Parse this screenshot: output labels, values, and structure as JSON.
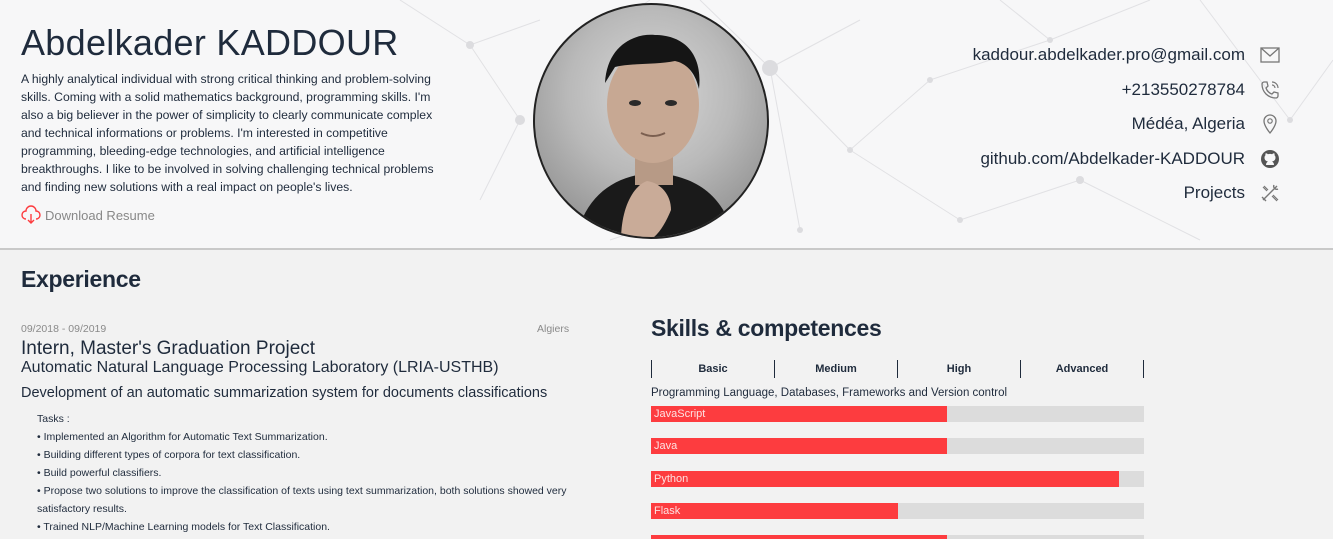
{
  "profile": {
    "name": "Abdelkader KADDOUR",
    "bio": "A highly analytical individual with strong critical thinking and problem-solving skills. Coming with a solid mathematics background, programming skills. I'm also a big believer in the power of simplicity to clearly communicate complex and technical informations or problems. I'm interested in competitive programming, bleeding-edge technologies, and artificial intelligence breakthroughs. I like to be involved in solving challenging technical problems and finding new solutions with a real impact on people's lives.",
    "download_label": "Download Resume"
  },
  "contact": [
    {
      "text": "kaddour.abdelkader.pro@gmail.com",
      "icon": "mail-icon"
    },
    {
      "text": "+213550278784",
      "icon": "phone-icon"
    },
    {
      "text": "Médéa, Algeria",
      "icon": "location-pin-icon"
    },
    {
      "text": "github.com/Abdelkader-KADDOUR",
      "icon": "github-icon"
    },
    {
      "text": "Projects",
      "icon": "tools-icon"
    }
  ],
  "experience": {
    "title": "Experience",
    "date": "09/2018 - 09/2019",
    "location": "Algiers",
    "job_title": "Intern, Master's Graduation Project",
    "org": "Automatic Natural Language Processing Laboratory (LRIA-USTHB)",
    "description": "Development of an automatic summarization system for documents classifications",
    "tasks_label": "Tasks :",
    "tasks": [
      "Implemented an Algorithm for Automatic Text Summarization.",
      "Building different types of corpora for text classification.",
      "Build powerful classifiers.",
      "Propose two solutions to improve the classification of texts using text summarization, both solutions showed very satisfactory results.",
      "Trained NLP/Machine Learning models for Text Classification."
    ]
  },
  "skills": {
    "title": "Skills & competences",
    "levels": [
      "Basic",
      "Medium",
      "High",
      "Advanced"
    ],
    "category": "Programming Language, Databases, Frameworks and Version control",
    "items": [
      {
        "name": "JavaScript",
        "level": 0.6
      },
      {
        "name": "Java",
        "level": 0.6
      },
      {
        "name": "Python",
        "level": 0.95
      },
      {
        "name": "Flask",
        "level": 0.5
      }
    ]
  },
  "colors": {
    "accent": "#fd3c3f",
    "text": "#1f2b3c",
    "track": "#dcdcdc"
  }
}
